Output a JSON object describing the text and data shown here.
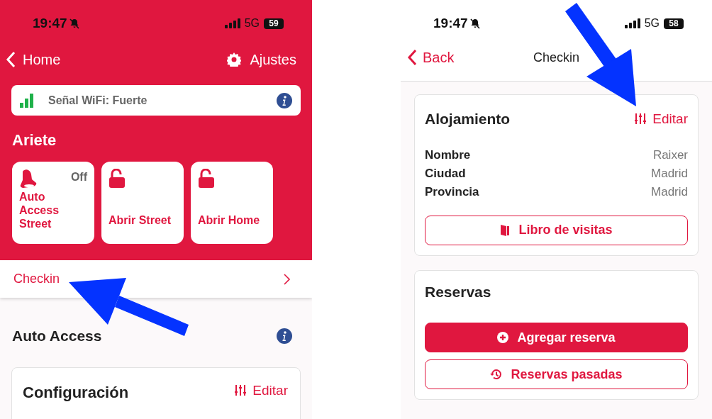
{
  "home_screen": {
    "status_bar": {
      "time": "19:47",
      "network": "5G",
      "battery": "59"
    },
    "nav": {
      "back": "Home",
      "settings": "Ajustes"
    },
    "wifi_banner": {
      "text": "Señal WiFi: Fuerte"
    },
    "section_title": "Ariete",
    "tiles": [
      {
        "kind": "bell",
        "label": "Auto Access Street",
        "status": "Off"
      },
      {
        "kind": "lock",
        "label": "Abrir Street"
      },
      {
        "kind": "lock",
        "label": "Abrir Home"
      }
    ],
    "checkin_row": {
      "label": "Checkin"
    },
    "auto_access": {
      "title": "Auto Access"
    },
    "config_card": {
      "title": "Configuración",
      "action": "Editar"
    }
  },
  "checkin_screen": {
    "status_bar": {
      "time": "19:47",
      "network": "5G",
      "battery": "58"
    },
    "nav": {
      "back": "Back",
      "title": "Checkin"
    },
    "lodging_card": {
      "title": "Alojamiento",
      "action": "Editar",
      "fields": [
        {
          "label": "Nombre",
          "value": "Raixer"
        },
        {
          "label": "Ciudad",
          "value": "Madrid"
        },
        {
          "label": "Provincia",
          "value": "Madrid"
        }
      ],
      "button": {
        "kind": "book",
        "label": "Libro de visitas",
        "primary": false
      }
    },
    "bookings_card": {
      "title": "Reservas",
      "buttons": [
        {
          "kind": "plus",
          "label": "Agregar reserva",
          "primary": true
        },
        {
          "kind": "history",
          "label": "Reservas pasadas",
          "primary": false
        }
      ]
    }
  }
}
